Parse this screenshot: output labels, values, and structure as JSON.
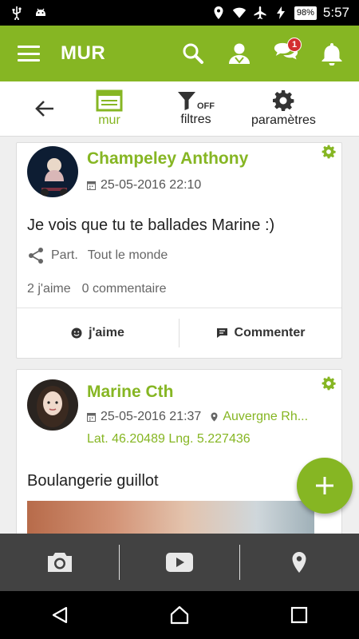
{
  "status_bar": {
    "time": "5:57",
    "battery": "98%"
  },
  "app_bar": {
    "title": "MUR",
    "notification_badge": "1"
  },
  "tabs": [
    {
      "label": "mur",
      "active": true
    },
    {
      "label": "filtres",
      "icon_text": "OFF",
      "active": false
    },
    {
      "label": "paramètres",
      "active": false
    }
  ],
  "posts": [
    {
      "author": "Champeley Anthony",
      "date": "25-05-2016 22:10",
      "text": "Je vois que tu te ballades Marine :)",
      "share_label": "Part.",
      "share_value": "Tout le monde",
      "likes": "2 j'aime",
      "comments": "0 commentaire",
      "like_button": "j'aime",
      "comment_button": "Commenter"
    },
    {
      "author": "Marine Cth",
      "date": "25-05-2016 21:37",
      "location": "Auvergne Rh...",
      "coords": "Lat. 46.20489  Lng. 5.227436",
      "text": "Boulangerie guillot"
    }
  ],
  "colors": {
    "accent": "#86b623",
    "bottom_bar": "#424242",
    "badge": "#d32f2f"
  }
}
